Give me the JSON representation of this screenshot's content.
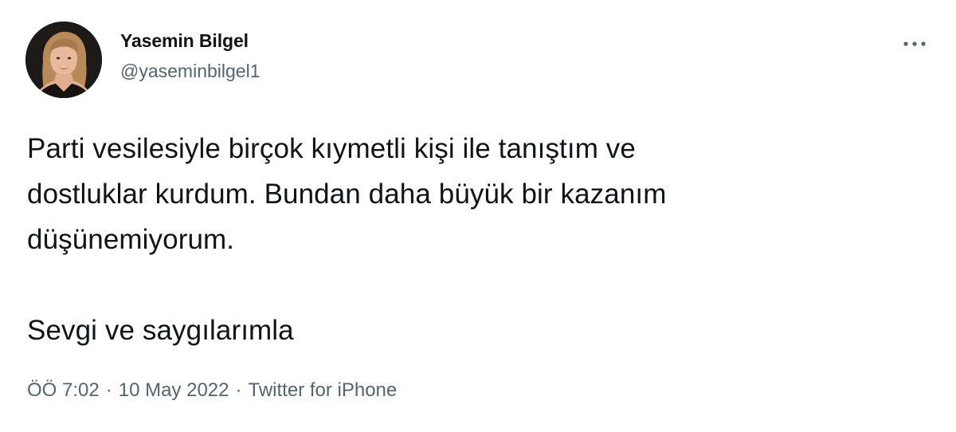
{
  "author": {
    "display_name": "Yasemin Bilgel",
    "handle": "@yaseminbilgel1",
    "avatar_icon": "profile-photo"
  },
  "more_icon": "more-options-icon",
  "tweet": {
    "text": "Parti vesilesiyle birçok kıymetli kişi ile tanıştım ve\ndostluklar kurdum. Bundan daha büyük bir kazanım\ndüşünemiyorum.\n\nSevgi ve saygılarımla"
  },
  "meta": {
    "time": "ÖÖ 7:02",
    "separator": "·",
    "date": "10 May 2022",
    "source": "Twitter for iPhone"
  },
  "colors": {
    "text_primary": "#0f1419",
    "text_secondary": "#536471",
    "background": "#ffffff"
  }
}
